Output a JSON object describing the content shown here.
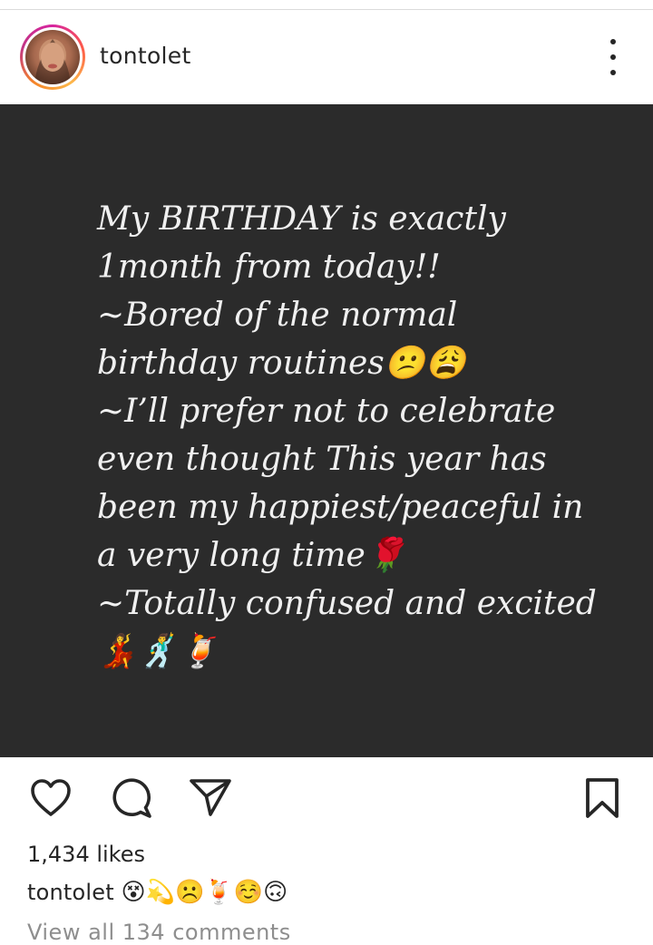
{
  "post": {
    "username": "tontolet",
    "image_text": {
      "lines": [
        "My BIRTHDAY is exactly",
        "1month from today!!",
        "~Bored of the normal",
        "birthday routines😕😩",
        "~I’ll prefer not to celebrate",
        "even thought This year has",
        "been my happiest/peaceful in",
        "a very long time🌹",
        "~Totally confused and excited",
        "💃🕺🍹"
      ]
    },
    "likes": "1,434 likes",
    "caption": {
      "username": "tontolet",
      "text": "😵💫☹️🍹☺️🙃"
    },
    "view_comments": "View all 134 comments"
  },
  "icons": {
    "avatar": "profile-photo",
    "more": "more-options-icon",
    "like": "heart-icon",
    "comment": "comment-icon",
    "share": "share-icon",
    "save": "bookmark-icon"
  },
  "colors": {
    "text": "#262626",
    "muted": "#8e8e8e",
    "image_bg": "#2b2b2b",
    "image_text": "#f0f0f0"
  }
}
